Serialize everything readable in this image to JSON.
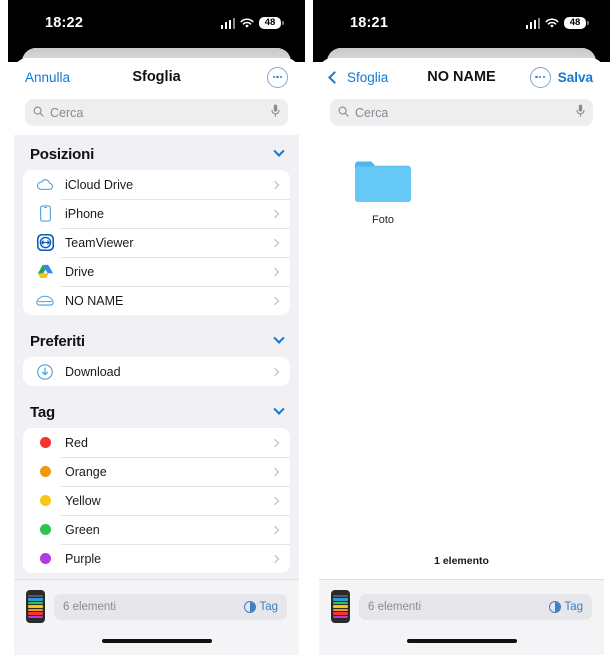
{
  "panels": [
    {
      "name": "browse-panel",
      "status": {
        "time": "18:22",
        "battery": "48",
        "signal_icon": "cellular-signal-icon",
        "wifi_icon": "wifi-icon",
        "battery_icon": "battery-icon"
      },
      "nav": {
        "left_label": "Annulla",
        "title": "Sfoglia",
        "more_icon": "ellipsis-circle-icon",
        "right_label": ""
      },
      "search": {
        "placeholder": "Cerca",
        "search_icon": "search-icon",
        "mic_icon": "microphone-icon"
      },
      "sections": [
        {
          "title": "Posizioni",
          "collapse_icon": "chevron-down-icon",
          "rows": [
            {
              "label": "iCloud Drive",
              "icon": "icloud-drive-icon"
            },
            {
              "label": "iPhone",
              "icon": "iphone-icon"
            },
            {
              "label": "TeamViewer",
              "icon": "teamviewer-icon"
            },
            {
              "label": "Drive",
              "icon": "google-drive-icon"
            },
            {
              "label": "NO NAME",
              "icon": "external-drive-icon"
            }
          ]
        },
        {
          "title": "Preferiti",
          "collapse_icon": "chevron-down-icon",
          "rows": [
            {
              "label": "Download",
              "icon": "download-circle-icon"
            }
          ]
        },
        {
          "title": "Tag",
          "collapse_icon": "chevron-down-icon",
          "rows": [
            {
              "label": "Red",
              "icon": "tag-dot-icon",
              "color": "#f3342f"
            },
            {
              "label": "Orange",
              "icon": "tag-dot-icon",
              "color": "#f09a0b"
            },
            {
              "label": "Yellow",
              "icon": "tag-dot-icon",
              "color": "#f5c518"
            },
            {
              "label": "Green",
              "icon": "tag-dot-icon",
              "color": "#2ec44f"
            },
            {
              "label": "Purple",
              "icon": "tag-dot-icon",
              "color": "#b13ae0"
            }
          ]
        }
      ],
      "bottom": {
        "thumbnail_icon": "phone-screenshot-thumbnail",
        "count_text": "6 elementi",
        "tag_label": "Tag",
        "tag_icon": "tag-circle-icon",
        "home_indicator": "home-indicator"
      }
    },
    {
      "name": "no-name-panel",
      "status": {
        "time": "18:21",
        "battery": "48",
        "signal_icon": "cellular-signal-icon",
        "wifi_icon": "wifi-icon",
        "battery_icon": "battery-icon"
      },
      "nav": {
        "left_label": "Sfoglia",
        "back_icon": "chevron-left-icon",
        "title": "NO NAME",
        "more_icon": "ellipsis-circle-icon",
        "right_label": "Salva"
      },
      "search": {
        "placeholder": "Cerca",
        "search_icon": "search-icon",
        "mic_icon": "microphone-icon"
      },
      "files": [
        {
          "name": "Foto",
          "icon": "folder-icon"
        }
      ],
      "item_count_text": "1 elemento",
      "bottom": {
        "thumbnail_icon": "phone-screenshot-thumbnail",
        "count_text": "6 elementi",
        "tag_label": "Tag",
        "tag_icon": "tag-circle-icon",
        "home_indicator": "home-indicator"
      }
    }
  ],
  "colors": {
    "accent_blue": "#1178d4",
    "sidebar_bg": "#f1f1f5",
    "folder_blue": "#5ac8f5",
    "status_bar": "#000000"
  }
}
